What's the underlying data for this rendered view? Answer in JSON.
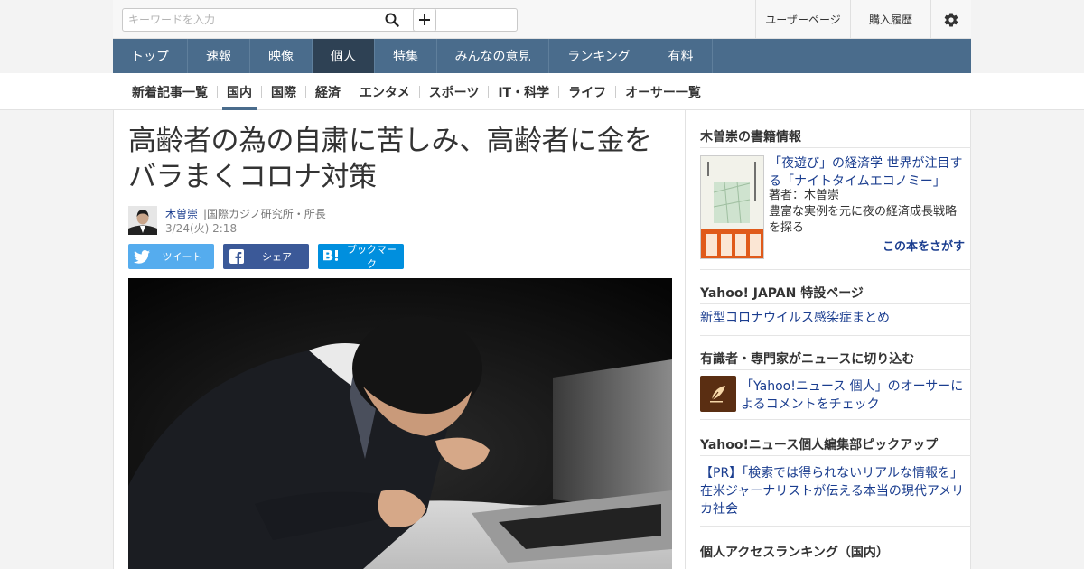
{
  "search": {
    "placeholder": "キーワードを入力"
  },
  "top_links": {
    "user_page": "ユーザーページ",
    "purchase_history": "購入履歴"
  },
  "main_nav": [
    "トップ",
    "速報",
    "映像",
    "個人",
    "特集",
    "みんなの意見",
    "ランキング",
    "有料"
  ],
  "main_nav_active": "個人",
  "sub_nav": [
    "新着記事一覧",
    "国内",
    "国際",
    "経済",
    "エンタメ",
    "スポーツ",
    "IT・科学",
    "ライフ",
    "オーサー一覧"
  ],
  "sub_nav_active": "国内",
  "article": {
    "headline_line1": "高齢者の為の自粛に苦しみ、高齢者に金を",
    "headline_line2": "バラまくコロナ対策",
    "author_name": "木曽崇",
    "author_title": "|国際カジノ研究所・所長",
    "date": "3/24(火) 2:18"
  },
  "share": {
    "tweet": "ツイート",
    "facebook": "シェア",
    "bookmark": "ブックマーク"
  },
  "sidebar": {
    "book_section": "木曽崇の書籍情報",
    "book_title": "「夜遊び」の経済学 世界が注目する「ナイトタイムエコノミー」",
    "book_author": "著者：木曽崇",
    "book_desc": "豊富な実例を元に夜の経済成長戦略を探る",
    "book_find": "この本をさがす",
    "special_section": "Yahoo! JAPAN 特設ページ",
    "special_link": "新型コロナウイルス感染症まとめ",
    "experts_section": "有識者・専門家がニュースに切り込む",
    "experts_link": "「Yahoo!ニュース 個人」のオーサーによるコメントをチェック",
    "pickup_section": "Yahoo!ニュース個人編集部ピックアップ",
    "pickup_link": "【PR】「検索では得られないリアルな情報を」在米ジャーナリストが伝える本当の現代アメリカ社会",
    "ranking_section": "個人アクセスランキング（国内）"
  },
  "colors": {
    "nav_bg": "#4a6c8c",
    "nav_active": "#2e4154",
    "link": "#1a3d8f",
    "twitter": "#55acee",
    "facebook": "#3b5998",
    "hatena": "#008fde"
  }
}
